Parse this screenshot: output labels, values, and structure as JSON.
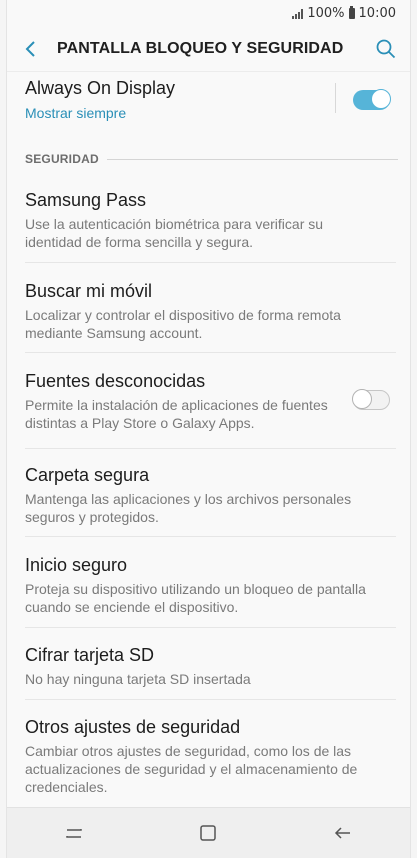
{
  "status": {
    "battery": "100%",
    "time": "10:00"
  },
  "header": {
    "title": "PANTALLA BLOQUEO Y SEGURIDAD"
  },
  "always_on": {
    "title": "Always On Display",
    "subtitle": "Mostrar siempre",
    "enabled": true
  },
  "section": {
    "label": "SEGURIDAD"
  },
  "items": [
    {
      "title": "Samsung Pass",
      "desc": "Use la autenticación biométrica para verificar su identidad de forma sencilla y segura."
    },
    {
      "title": "Buscar mi móvil",
      "desc": "Localizar y controlar el dispositivo de forma remota mediante Samsung account."
    },
    {
      "title": "Fuentes desconocidas",
      "desc": "Permite la instalación de aplicaciones de fuentes distintas a Play Store o Galaxy Apps.",
      "toggle": false
    },
    {
      "title": "Carpeta segura",
      "desc": "Mantenga las aplicaciones y los archivos personales seguros y protegidos."
    },
    {
      "title": "Inicio seguro",
      "desc": "Proteja su dispositivo utilizando un bloqueo de pantalla cuando se enciende el dispositivo."
    },
    {
      "title": "Cifrar tarjeta SD",
      "desc": "No hay ninguna tarjeta SD insertada"
    },
    {
      "title": "Otros ajustes de seguridad",
      "desc": "Cambiar otros ajustes de seguridad, como los de las actualizaciones de seguridad y el almacenamiento de credenciales."
    }
  ],
  "icons": {
    "back": "chevron-left-icon",
    "search": "search-icon",
    "recents": "recent-apps-icon",
    "home": "home-icon",
    "nav_back": "back-arrow-icon"
  },
  "colors": {
    "accent": "#56b4d8",
    "link": "#2a8fb7"
  }
}
